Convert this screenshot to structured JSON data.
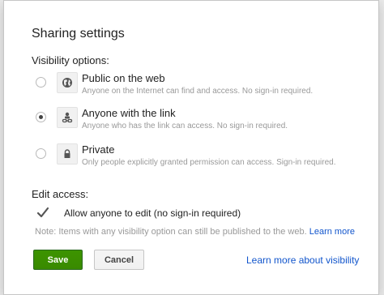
{
  "dialog": {
    "title": "Sharing settings"
  },
  "visibility": {
    "label": "Visibility options:",
    "options": [
      {
        "title": "Public on the web",
        "description": "Anyone on the Internet can find and access. No sign-in required.",
        "icon": "globe-icon",
        "selected": false
      },
      {
        "title": "Anyone with the link",
        "description": "Anyone who has the link can access. No sign-in required.",
        "icon": "people-link-icon",
        "selected": true
      },
      {
        "title": "Private",
        "description": "Only people explicitly granted permission can access. Sign-in required.",
        "icon": "lock-icon",
        "selected": false
      }
    ]
  },
  "edit_access": {
    "label": "Edit access:",
    "checkbox_label": "Allow anyone to edit (no sign-in required)",
    "checked": true
  },
  "note": {
    "text": "Note: Items with any visibility option can still be published to the web.",
    "link": "Learn more"
  },
  "buttons": {
    "save": "Save",
    "cancel": "Cancel"
  },
  "learn_more_visibility": "Learn more about visibility",
  "colors": {
    "save_bg": "#3d9400",
    "link": "#1155cc",
    "muted": "#999999"
  }
}
